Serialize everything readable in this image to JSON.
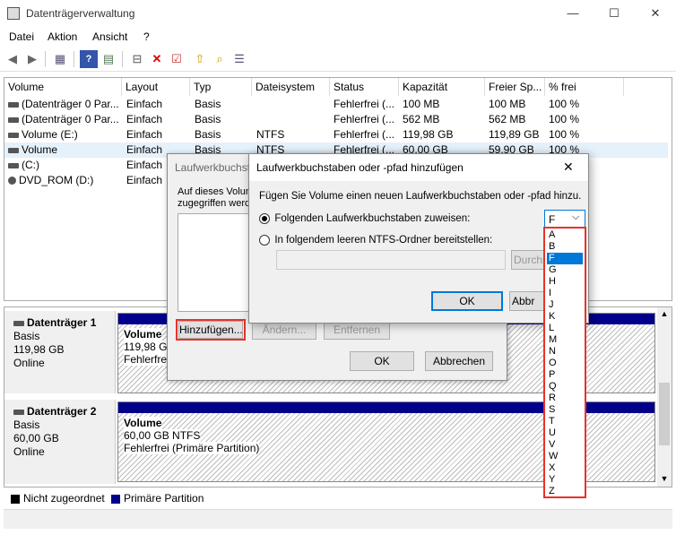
{
  "window": {
    "title": "Datenträgerverwaltung",
    "minimize": "—",
    "maximize": "☐",
    "close": "✕"
  },
  "menu": [
    "Datei",
    "Aktion",
    "Ansicht",
    "?"
  ],
  "toolbar": {
    "icons": [
      "back-icon",
      "forward-icon",
      "properties-icon",
      "help-icon",
      "view-icon",
      "connect-icon",
      "delete-icon",
      "check-icon",
      "up-icon",
      "search-icon",
      "list-icon"
    ]
  },
  "list": {
    "columns": [
      "Volume",
      "Layout",
      "Typ",
      "Dateisystem",
      "Status",
      "Kapazität",
      "Freier Sp...",
      "% frei"
    ],
    "rows": [
      {
        "volume": "(Datenträger 0 Par...",
        "layout": "Einfach",
        "typ": "Basis",
        "fs": "",
        "status": "Fehlerfrei (...",
        "cap": "100 MB",
        "free": "100 MB",
        "pct": "100 %"
      },
      {
        "volume": "(Datenträger 0 Par...",
        "layout": "Einfach",
        "typ": "Basis",
        "fs": "",
        "status": "Fehlerfrei (...",
        "cap": "562 MB",
        "free": "562 MB",
        "pct": "100 %"
      },
      {
        "volume": "Volume (E:)",
        "layout": "Einfach",
        "typ": "Basis",
        "fs": "NTFS",
        "status": "Fehlerfrei (...",
        "cap": "119,98 GB",
        "free": "119,89 GB",
        "pct": "100 %"
      },
      {
        "volume": "Volume",
        "layout": "Einfach",
        "typ": "Basis",
        "fs": "NTFS",
        "status": "Fehlerfrei (...",
        "cap": "60,00 GB",
        "free": "59,90 GB",
        "pct": "100 %"
      },
      {
        "volume": "(C:)",
        "layout": "Einfach",
        "typ": "",
        "fs": "",
        "status": "",
        "cap": "",
        "free": "",
        "pct": ""
      },
      {
        "volume": "DVD_ROM (D:)",
        "layout": "Einfach",
        "typ": "",
        "fs": "",
        "status": "",
        "cap": "",
        "free": "",
        "pct": ""
      }
    ]
  },
  "disks": [
    {
      "name": "Datenträger 1",
      "type": "Basis",
      "size": "119,98 GB",
      "state": "Online",
      "part_title": "Volume",
      "part_size": "119,98 GB",
      "part_status": "Fehlerfrei"
    },
    {
      "name": "Datenträger 2",
      "type": "Basis",
      "size": "60,00 GB",
      "state": "Online",
      "part_title": "Volume",
      "part_size": "60,00 GB NTFS",
      "part_status": "Fehlerfrei (Primäre Partition)"
    }
  ],
  "legend": {
    "unallocated": "Nicht zugeordnet",
    "primary": "Primäre Partition"
  },
  "bg_dialog": {
    "title": "Laufwerkbuchst",
    "text1": "Auf dieses Volum",
    "text2": "zugegriffen werde",
    "add": "Hinzufügen...",
    "change": "Ändern...",
    "remove": "Entfernen",
    "ok": "OK",
    "cancel": "Abbrechen"
  },
  "fg_dialog": {
    "title": "Laufwerkbuchstaben oder -pfad hinzufügen",
    "instruction": "Fügen Sie Volume einen neuen Laufwerkbuchstaben oder -pfad hinzu.",
    "opt1": "Folgenden Laufwerkbuchstaben zuweisen:",
    "opt2": "In folgendem leeren NTFS-Ordner bereitstellen:",
    "selected_letter": "F",
    "browse": "Durchs",
    "ok": "OK",
    "cancel": "Abbr"
  },
  "letters": [
    "A",
    "B",
    "F",
    "G",
    "H",
    "I",
    "J",
    "K",
    "L",
    "M",
    "N",
    "O",
    "P",
    "Q",
    "R",
    "S",
    "T",
    "U",
    "V",
    "W",
    "X",
    "Y",
    "Z"
  ],
  "colors": {
    "primary": "#00008b",
    "highlight": "#e8322a",
    "select": "#0078d7"
  }
}
